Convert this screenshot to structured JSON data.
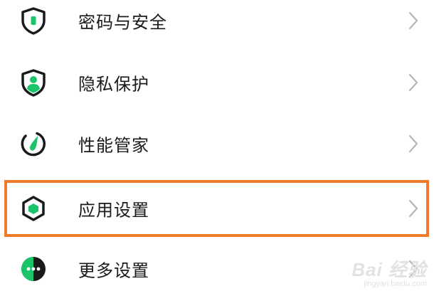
{
  "settings": {
    "items": [
      {
        "label": "密码与安全",
        "icon": "shield-lock-icon"
      },
      {
        "label": "隐私保护",
        "icon": "privacy-shield-icon"
      },
      {
        "label": "性能管家",
        "icon": "performance-gauge-icon"
      },
      {
        "label": "应用设置",
        "icon": "app-hexagon-icon",
        "highlighted": true
      },
      {
        "label": "更多设置",
        "icon": "more-dots-icon"
      }
    ]
  },
  "colors": {
    "accent_green": "#1bc46b",
    "icon_dark": "#1a1a1a",
    "highlight_border": "#f07a2a",
    "chevron": "#b5b5b5"
  },
  "watermark": {
    "logo": "Bai 经验",
    "url": "jingyan.baidu.com"
  }
}
